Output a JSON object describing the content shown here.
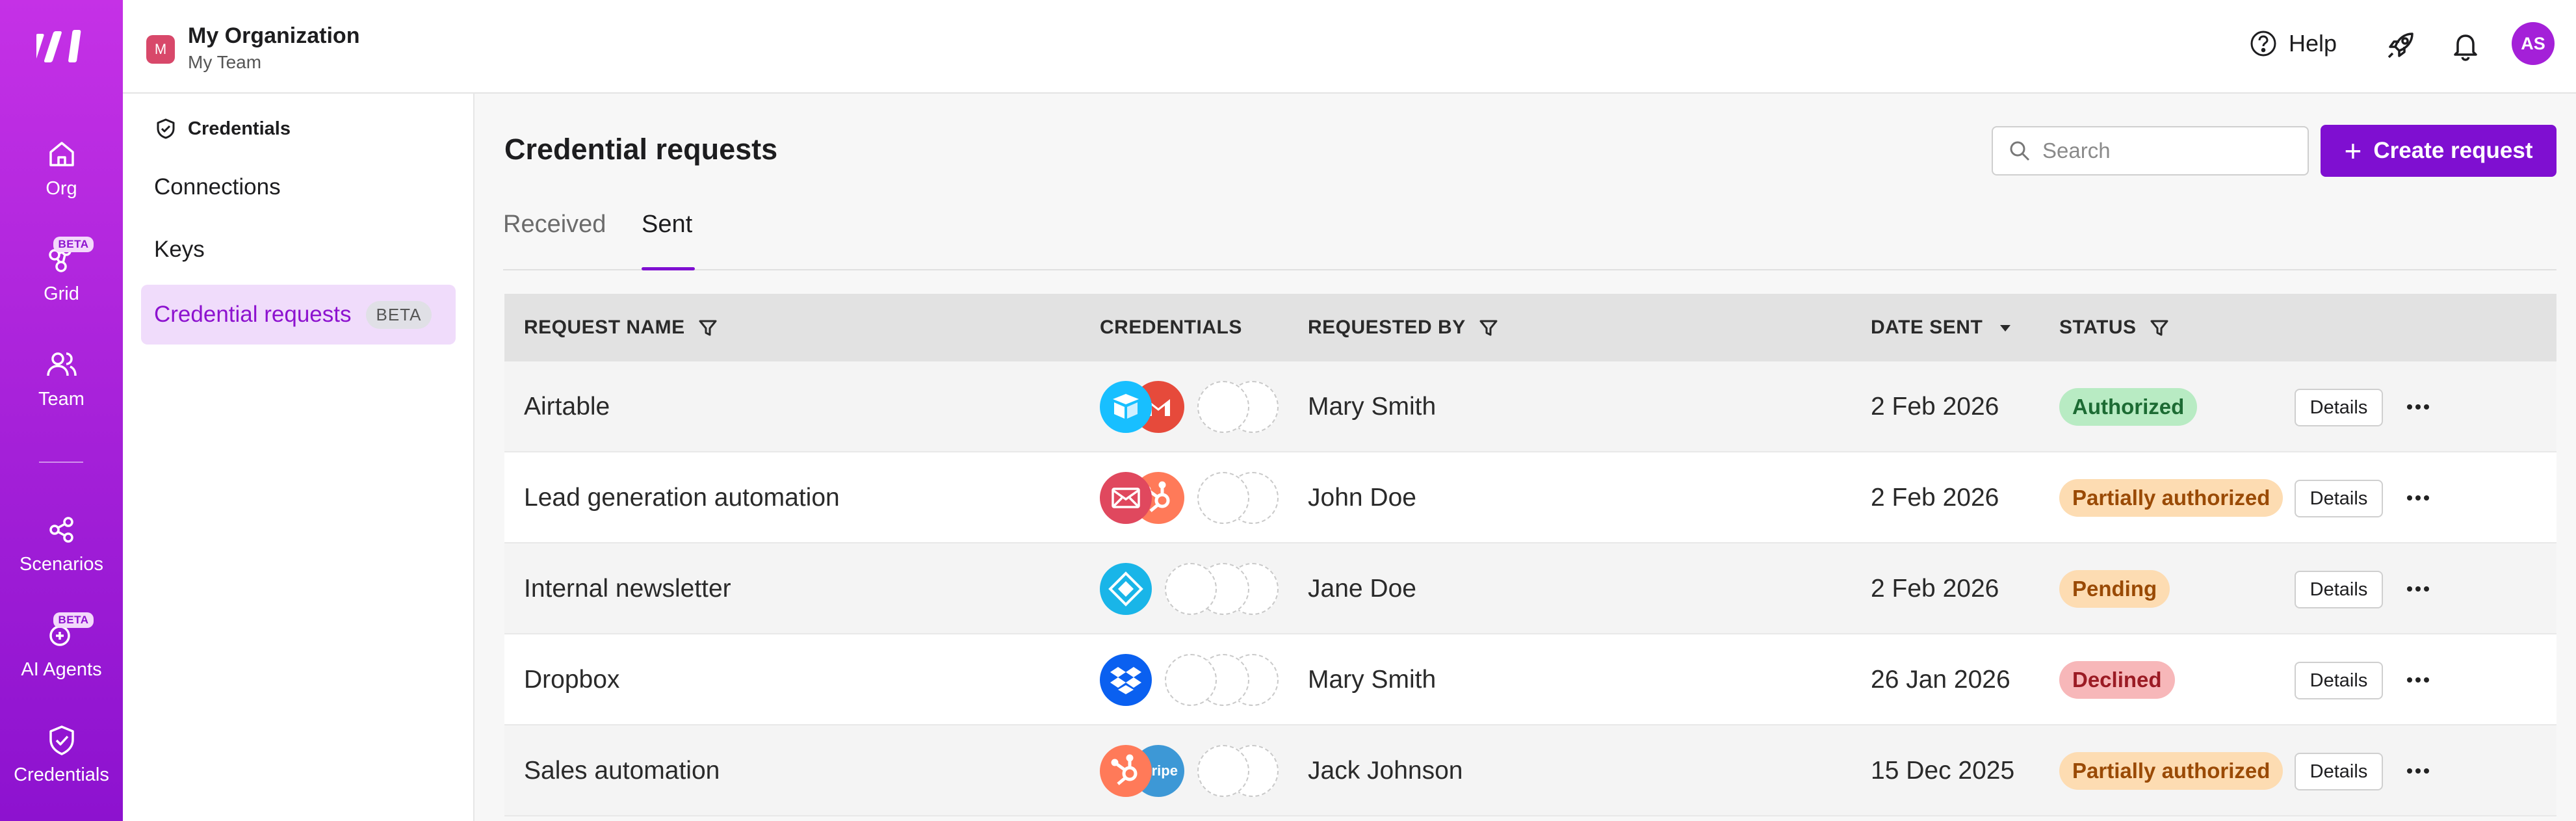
{
  "rail": {
    "items": [
      {
        "label": "Org",
        "icon": "home-icon"
      },
      {
        "label": "Grid",
        "icon": "grid-icon",
        "badge": "BETA"
      },
      {
        "label": "Team",
        "icon": "team-icon"
      },
      {
        "label": "Scenarios",
        "icon": "share-icon"
      },
      {
        "label": "AI Agents",
        "icon": "ai-agent-icon",
        "badge": "BETA"
      },
      {
        "label": "Credentials",
        "icon": "shield-check-icon"
      }
    ]
  },
  "header": {
    "org_initial": "M",
    "org_name": "My Organization",
    "team_name": "My Team",
    "help_label": "Help",
    "avatar_initials": "AS"
  },
  "subnav": {
    "section_title": "Credentials",
    "items": [
      {
        "label": "Connections"
      },
      {
        "label": "Keys"
      },
      {
        "label": "Credential requests",
        "badge": "BETA",
        "active": true
      }
    ]
  },
  "main": {
    "title": "Credential requests",
    "search_placeholder": "Search",
    "create_label": "Create request",
    "tabs": [
      {
        "label": "Received",
        "active": false
      },
      {
        "label": "Sent",
        "active": true
      }
    ],
    "columns": {
      "name": "REQUEST NAME",
      "credentials": "CREDENTIALS",
      "requested_by": "REQUESTED BY",
      "date_sent": "DATE SENT",
      "status": "STATUS"
    },
    "details_label": "Details",
    "rows": [
      {
        "name": "Airtable",
        "requested_by": "Mary Smith",
        "date": "2 Feb 2026",
        "status": "Authorized",
        "creds": [
          "airtable-icon",
          "gmail-icon"
        ]
      },
      {
        "name": "Lead generation automation",
        "requested_by": "John Doe",
        "date": "2 Feb 2026",
        "status": "Partially authorized",
        "creds": [
          "email-icon",
          "hubspot-icon"
        ]
      },
      {
        "name": "Internal newsletter",
        "requested_by": "Jane Doe",
        "date": "2 Feb 2026",
        "status": "Pending",
        "creds": [
          "diamond-app-icon"
        ]
      },
      {
        "name": "Dropbox",
        "requested_by": "Mary Smith",
        "date": "26 Jan 2026",
        "status": "Declined",
        "creds": [
          "dropbox-icon"
        ]
      },
      {
        "name": "Sales automation",
        "requested_by": "Jack Johnson",
        "date": "15 Dec 2025",
        "status": "Partially authorized",
        "creds": [
          "hubspot-icon",
          "stripe-icon"
        ],
        "stripe_text": "stripe"
      }
    ]
  },
  "colors": {
    "accent": "#7f0fd1",
    "authorized_bg": "#b8ebc3",
    "authorized_fg": "#1c6b33",
    "partial_bg": "#fddcb2",
    "partial_fg": "#9a4a05",
    "pending_bg": "#fddcb2",
    "pending_fg": "#9a4a05",
    "declined_bg": "#f7b7b9",
    "declined_fg": "#9b1b24"
  }
}
